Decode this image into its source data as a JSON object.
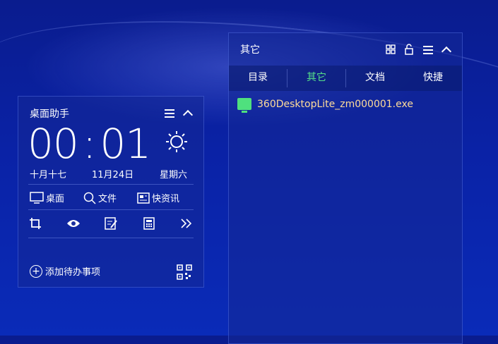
{
  "assistant": {
    "title": "桌面助手",
    "time_hour": "00",
    "time_sep": ":",
    "time_min": "01",
    "lunar_date": "十月十七",
    "date": "11月24日",
    "weekday": "星期六",
    "tools": [
      "桌面",
      "文件",
      "快资讯"
    ],
    "add_todo": "添加待办事项"
  },
  "other": {
    "title": "其它",
    "tabs": [
      "目录",
      "其它",
      "文档",
      "快捷"
    ],
    "active_tab": "其它",
    "file_name": "360DesktopLite_zm000001.exe"
  },
  "colors": {
    "accent": "#56e08a",
    "file_text": "#ffdc9a"
  }
}
